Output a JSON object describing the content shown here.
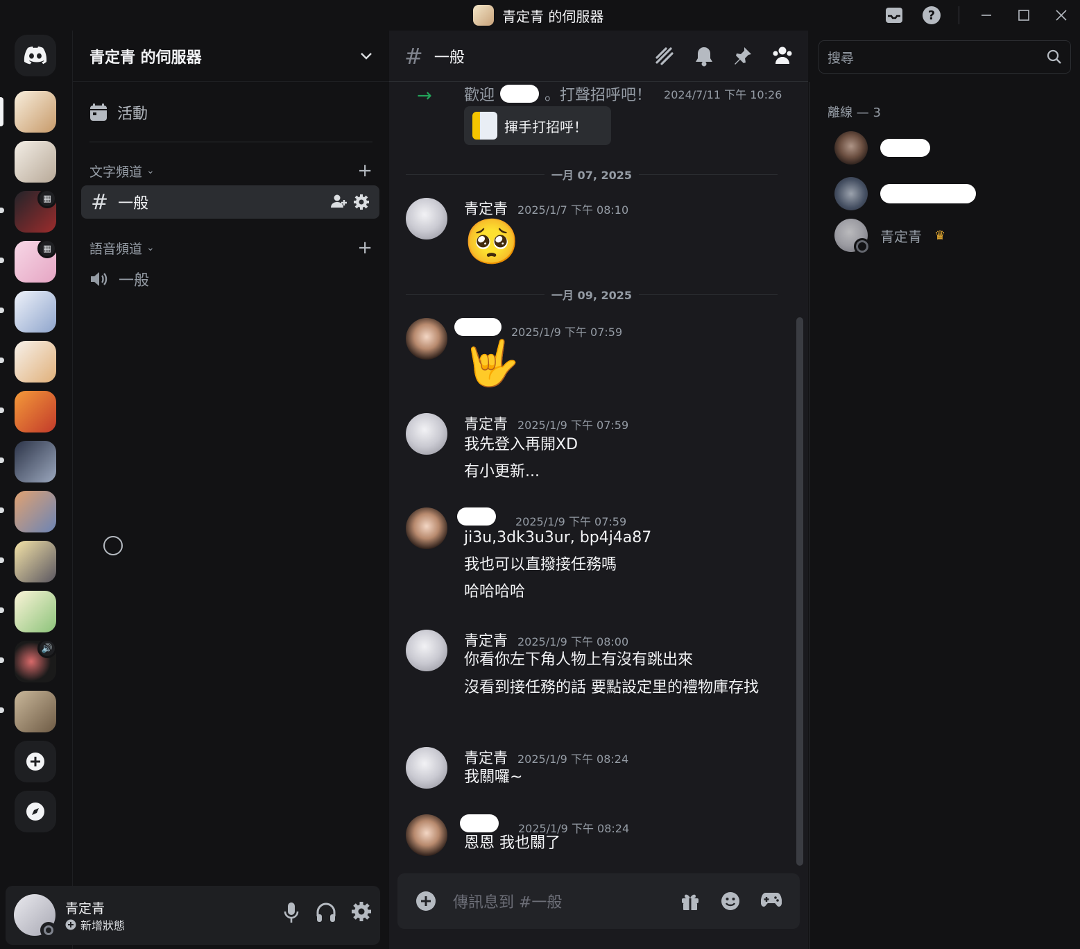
{
  "window": {
    "title": "青定青 的伺服器"
  },
  "server": {
    "name": "青定青 的伺服器",
    "events_label": "活動",
    "text_category": "文字頻道",
    "voice_category": "語音頻道",
    "text_channel": "一般",
    "voice_channel": "一般"
  },
  "user": {
    "name": "青定青",
    "status_action": "新增狀態"
  },
  "chat": {
    "channel_name": "一般",
    "search_placeholder": "搜尋",
    "composer_placeholder": "傳訊息到 #一般",
    "welcome_prefix": "歡迎",
    "welcome_suffix": "。打聲招呼吧！",
    "welcome_time": "2024/7/11 下午 10:26",
    "wave_button": "揮手打招呼！",
    "dividers": [
      "一月 07, 2025",
      "一月 09, 2025"
    ],
    "messages": [
      {
        "author": "青定青",
        "time": "2025/1/7 下午 08:10",
        "emoji": "🥺"
      },
      {
        "author": "",
        "time": "2025/1/9 下午 07:59",
        "emoji": "🤟"
      },
      {
        "author": "青定青",
        "time": "2025/1/9 下午 07:59",
        "lines": [
          "我先登入再開XD",
          "有小更新..."
        ]
      },
      {
        "author": "",
        "time": "2025/1/9 下午 07:59",
        "lines": [
          "ji3u,3dk3u3ur, bp4j4a87",
          "我也可以直撥接任務嗎",
          "哈哈哈哈"
        ]
      },
      {
        "author": "青定青",
        "time": "2025/1/9 下午 08:00",
        "lines": [
          "你看你左下角人物上有沒有跳出來",
          "沒看到接任務的話 要點設定里的禮物庫存找"
        ]
      },
      {
        "author": "青定青",
        "time": "2025/1/9 下午 08:24",
        "lines": [
          "我關囉~"
        ]
      },
      {
        "author": "",
        "time": "2025/1/9 下午 08:24",
        "lines": [
          "恩恩 我也關了"
        ]
      }
    ]
  },
  "members": {
    "header": "離線 — 3",
    "list": [
      {
        "name": ""
      },
      {
        "name": ""
      },
      {
        "name": "青定青",
        "crown": "♛"
      }
    ]
  },
  "icons": {
    "inbox": "inbox-icon",
    "help": "help-icon",
    "minimize": "minimize-icon",
    "maximize": "maximize-icon",
    "close": "close-icon",
    "threads": "threads-icon",
    "bell": "bell-icon",
    "pin": "pin-icon",
    "members": "members-icon",
    "search": "search-icon"
  },
  "colors": {
    "accent_green": "#23a55a",
    "crown": "#f0b232"
  }
}
